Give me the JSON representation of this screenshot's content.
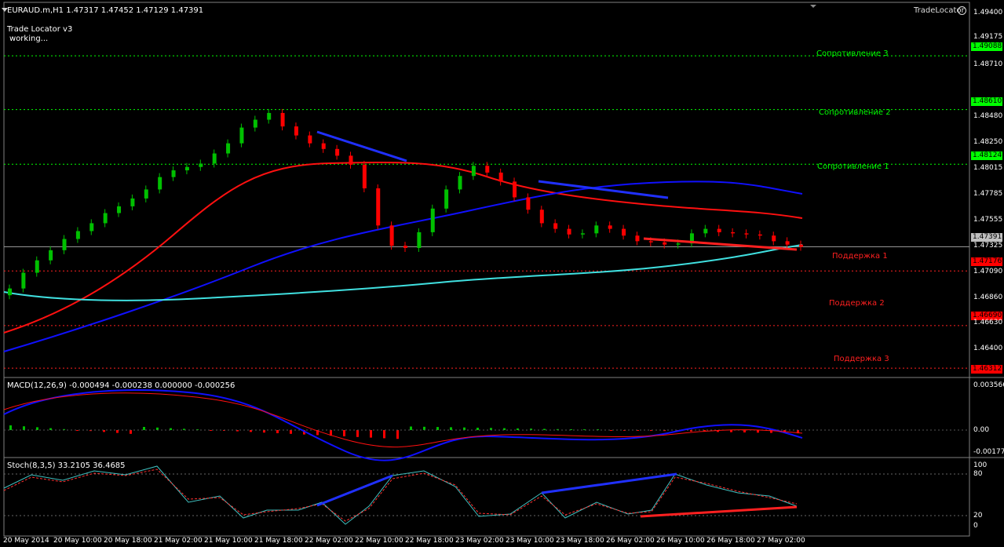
{
  "header": {
    "title": "EURAUD.m,H1  1.47317 1.47452 1.47129 1.47391",
    "indicator_name": "Trade Locator v3",
    "indicator_status": "working..."
  },
  "brand": {
    "label": "TradeLocator"
  },
  "levels": {
    "r3": {
      "label": "Сопротивление 3",
      "price": "1.49088"
    },
    "r2": {
      "label": "Сопротивление 2",
      "price": "1.48610"
    },
    "r1": {
      "label": "Сопротивление 1",
      "price": "1.48124"
    },
    "s1": {
      "label": "Поддержка 1",
      "price": "1.47176"
    },
    "s2": {
      "label": "Поддержка 2",
      "price": "1.46690"
    },
    "s3": {
      "label": "Поддержка 3",
      "price": "1.46312"
    },
    "current": {
      "price": "1.47391"
    }
  },
  "price_axis": [
    "1.49400",
    "1.49175",
    "1.48940",
    "1.48710",
    "1.48480",
    "1.48250",
    "1.48015",
    "1.47785",
    "1.47555",
    "1.47325",
    "1.47090",
    "1.46860",
    "1.46630",
    "1.46400"
  ],
  "macd": {
    "label": "MACD(12,26,9) -0.000494 -0.000238 0.000000 -0.000256",
    "axis": [
      "0.003566",
      "0.00",
      "-0.001774"
    ]
  },
  "stoch": {
    "label": "Stoch(8,3,5) 33.2105 36.4685",
    "axis": [
      "100",
      "80",
      "20",
      "0"
    ]
  },
  "time_axis": [
    "20 May 2014",
    "20 May 10:00",
    "20 May 18:00",
    "21 May 02:00",
    "21 May 10:00",
    "21 May 18:00",
    "22 May 02:00",
    "22 May 10:00",
    "22 May 18:00",
    "23 May 02:00",
    "23 May 10:00",
    "23 May 18:00",
    "26 May 02:00",
    "26 May 10:00",
    "26 May 18:00",
    "27 May 02:00"
  ],
  "colors": {
    "bull": "#00c000",
    "bear": "#ff0000",
    "resistance": "#00ff00",
    "support": "#ff2020",
    "ma_red": "#ff1010",
    "ma_blue": "#1010ff",
    "ma_cyan": "#40e0e0",
    "grid_sep": "#808080"
  },
  "chart_data": {
    "type": "candlestick",
    "symbol": "EURAUD.m",
    "timeframe": "H1",
    "ohlc_last": {
      "open": 1.47317,
      "high": 1.47452,
      "low": 1.47129,
      "close": 1.47391
    },
    "close_series": [
      1.4702,
      1.4716,
      1.4727,
      1.4736,
      1.4746,
      1.4753,
      1.476,
      1.4769,
      1.4775,
      1.4782,
      1.479,
      1.4801,
      1.4807,
      1.481,
      1.4813,
      1.4822,
      1.4831,
      1.4845,
      1.4852,
      1.4858,
      1.4846,
      1.4838,
      1.4831,
      1.4826,
      1.482,
      1.4812,
      1.4791,
      1.4758,
      1.474,
      1.4738,
      1.4752,
      1.4773,
      1.479,
      1.4802,
      1.4811,
      1.4805,
      1.4797,
      1.4783,
      1.4772,
      1.476,
      1.4755,
      1.475,
      1.4751,
      1.4758,
      1.4755,
      1.4749,
      1.4744,
      1.4743,
      1.4741,
      1.4742,
      1.4751,
      1.4755,
      1.4752,
      1.4751,
      1.475,
      1.4749,
      1.4744,
      1.4741,
      1.4739
    ],
    "resistance_levels": [
      1.49088,
      1.4861,
      1.48124
    ],
    "support_levels": [
      1.47176,
      1.4669,
      1.46312
    ],
    "price_range": [
      1.4625,
      1.495
    ]
  }
}
